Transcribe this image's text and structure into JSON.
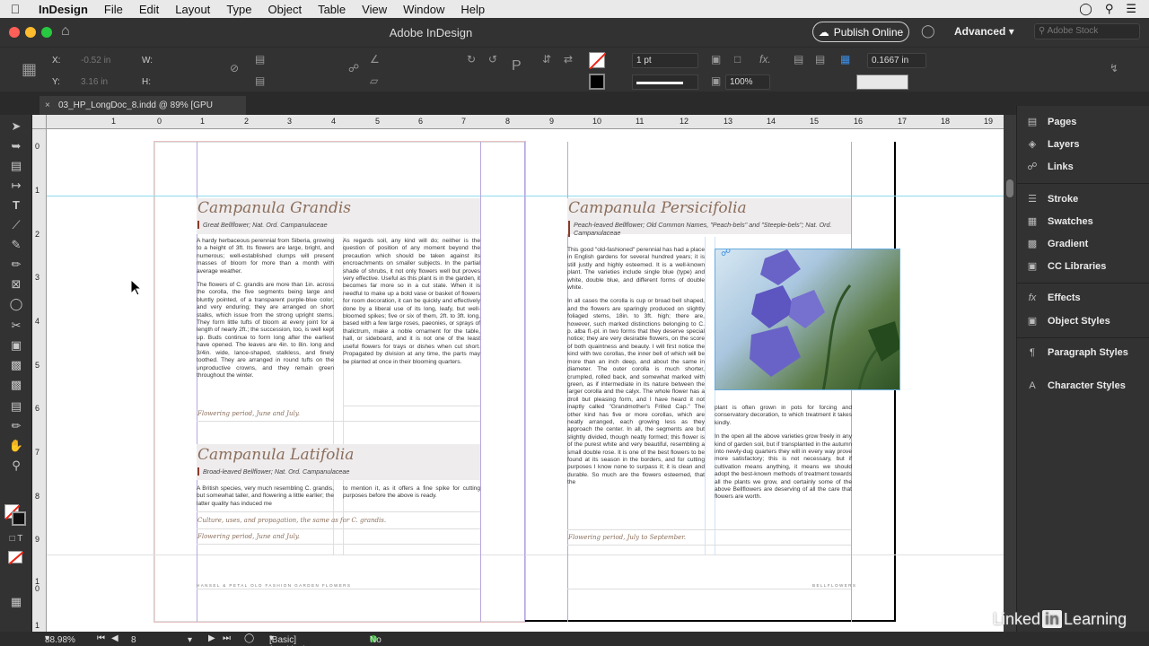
{
  "menubar": {
    "app": "InDesign",
    "items": [
      "File",
      "Edit",
      "Layout",
      "Type",
      "Object",
      "Table",
      "View",
      "Window",
      "Help"
    ]
  },
  "titlebar": {
    "title": "Adobe InDesign",
    "publish": "Publish Online",
    "workspace": "Advanced",
    "stock_placeholder": "Adobe Stock"
  },
  "control": {
    "x_label": "X:",
    "x_value": "-0.52 in",
    "y_label": "Y:",
    "y_value": "3.16 in",
    "w_label": "W:",
    "h_label": "H:",
    "stroke_weight": "1 pt",
    "opacity": "100%",
    "gutter": "0.1667 in"
  },
  "tab": {
    "name": "03_HP_LongDoc_8.indd @ 89% [GPU Preview]"
  },
  "ruler_h": [
    "1",
    "1",
    "0",
    "1",
    "2",
    "3",
    "4",
    "5",
    "6",
    "7",
    "8",
    "9",
    "10",
    "11",
    "12",
    "13",
    "14",
    "15",
    "16",
    "17",
    "18",
    "19"
  ],
  "ruler_v": [
    "0",
    "1",
    "2",
    "3",
    "4",
    "5",
    "6",
    "7",
    "8",
    "9",
    "1 0",
    "1"
  ],
  "left_page": {
    "title1": "Campanula Grandis",
    "sub1": "Great Bellflower; Nat. Ord. Campanulaceae",
    "col1a": "A hardy herbaceous perennial from Siberia, growing to a height of 3ft. Its flowers are large, bright, and numerous; well-established clumps will present masses of bloom for more than a month with average weather.",
    "col1b": "The flowers of C. grandis are more than 1in. across the corolla, the five segments being large and bluntly pointed, of a transparent purple-blue color, and very enduring; they are arranged on short stalks, which issue from the strong upright stems. They form little tufts of bloom at every joint for a length of nearly 2ft.; the succession, too, is well kept up. Buds continue to form long after the earliest have opened. The leaves are 4in. to 8in. long and 3/4in. wide, lance-shaped, stalkless, and finely toothed. They are arranged in round tufts on the unproductive crowns, and they remain green throughout the winter.",
    "col2a": "As regards soil, any kind will do; neither is the question of position of any moment beyond the precaution which should be taken against its encroachments on smaller subjects. In the partial shade of shrubs, it not only flowers well but proves very effective. Useful as this plant is in the garden, it becomes far more so in a cut state. When it is needful to make up a bold vase or basket of flowers for room decoration, it can be quickly and effectively done by a liberal use of its long, leafy, but well-bloomed spikes; five or six of them, 2ft. to 3ft. long, based with a few large roses, paeonies, or sprays of thalictrum, make a noble ornament for the table, hall, or sideboard, and it is not one of the least useful flowers for trays or dishes when cut short. Propagated by division at any time, the parts may be planted at once in their blooming quarters.",
    "period1": "Flowering period, June and July.",
    "title2": "Campanula Latifolia",
    "sub2": "Broad-leaved Bellflower; Nat. Ord. Campanulaceae",
    "col1c": "A British species, very much resembling C. grandis, but somewhat taller, and flowering a little earlier; the latter quality has induced me",
    "col2c": "to mention it, as it offers a fine spike for cutting purposes before the above is ready.",
    "culture": "Culture, uses, and propagation, the same as for C. grandis.",
    "period2": "Flowering period, June and July.",
    "footer": "HANSEL & PETAL OLD FASHION GARDEN FLOWERS"
  },
  "right_page": {
    "title": "Campanula Persicifolia",
    "sub": "Peach-leaved Bellflower; Old Common Names, \"Peach-bels\" and \"Steeple-bels\"; Nat. Ord. Campanulaceae",
    "col1a": "This good \"old-fashioned\" perennial has had a place in English gardens for several hundred years; it is still justly and highly esteemed. It is a well-known plant. The varieties include single blue (type) and white, double blue, and different forms of double white.",
    "col1b": "In all cases the corolla is cup or broad bell shaped, and the flowers are sparingly produced on slightly foliaged stems, 18in. to 3ft. high; there are, however, such marked distinctions belonging to C. p. alba fl.-pl. in two forms that they deserve special notice; they are very desirable flowers, on the score of both quaintness and beauty. I will first notice the kind with two corollas, the inner bell of which will be more than an inch deep, and about the same in diameter. The outer corolla is much shorter, crumpled, rolled back, and somewhat marked with green, as if intermediate in its nature between the larger corolla and the calyx. The whole flower has a droll but pleasing form, and I have heard it not inaptly called \"Grandmother's Frilled Cap.\" The other kind has five or more corollas, which are neatly arranged, each growing less as they approach the center. In all, the segments are but slightly divided, though neatly formed; this flower is of the purest white and very beautiful, resembling a small double rose. It is one of the best flowers to be found at its season in the borders, and for cutting purposes I know none to surpass it; it is clean and durable. So much are the flowers esteemed, that the",
    "col2a": "plant is often grown in pots for forcing and conservatory decoration, to which treatment it takes kindly.",
    "col2b": "In the open all the above varieties grow freely in any kind of garden soil, but if transplanted in the autumn into newly-dug quarters they will in every way prove more satisfactory; this is not necessary, but if cultivation means anything, it means we should adopt the best-known methods of treatment towards all the plants we grow, and certainly some of the above Bellflowers are deserving of all the care that flowers are worth.",
    "period": "Flowering period, July to September.",
    "footer": "BELLFLOWERS"
  },
  "panels": [
    "Pages",
    "Layers",
    "Links",
    "Stroke",
    "Swatches",
    "Gradient",
    "CC Libraries",
    "Effects",
    "Object Styles",
    "Paragraph Styles",
    "Character Styles"
  ],
  "status": {
    "zoom": "88.98%",
    "page": "8",
    "style": "[Basic] (working)",
    "errors": "No errors"
  },
  "watermark": {
    "pre": "Linked",
    "in": "in",
    "post": "Learning"
  },
  "colors": {
    "accent_title": "#8a6e5b",
    "guide": "#b6a7dd",
    "ok": "#3bb33b"
  }
}
